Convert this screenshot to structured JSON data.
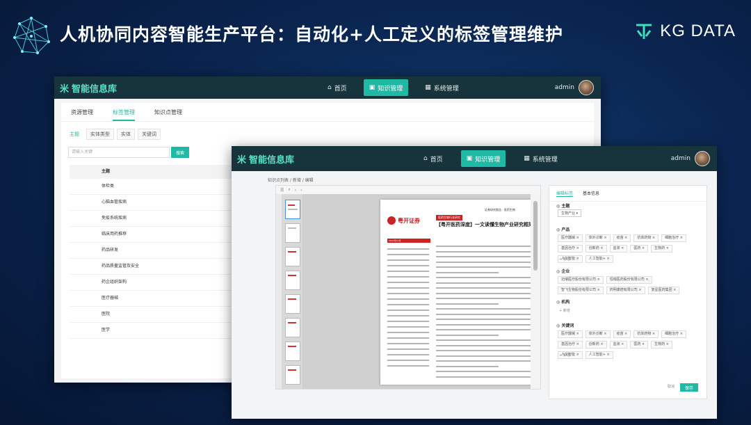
{
  "slide": {
    "title": "人机协同内容智能生产平台：自动化+人工定义的标签管理维护",
    "brand": "KG DATA"
  },
  "app": {
    "logo_text": "智能信息库",
    "nav": {
      "home": "首页",
      "knowledge": "知识管理",
      "system": "系统管理"
    },
    "user": "admin"
  },
  "back_window": {
    "tabs": [
      "资源管理",
      "标签管理",
      "知识点管理"
    ],
    "subtabs": [
      "主题",
      "实体类型",
      "实体",
      "关键词"
    ],
    "search_placeholder": "请输入关键",
    "search_button": "搜索",
    "table_header": "主题",
    "rows": [
      "体检类",
      "心脑血管疾病",
      "免疫系统疾病",
      "临床用药推荐",
      "药品研发",
      "药品质量监管及安全",
      "药企组织架构",
      "医疗器械",
      "医院",
      "医学"
    ]
  },
  "front_window": {
    "breadcrumb": "知识点列表 / 新增 / 编辑",
    "document": {
      "header_line": "证券研究报告 · 医药生物",
      "broker": "粤开证券",
      "tag": "医药生物行业研究",
      "title": "【粤开医药深度】一文读懂生物产业研究框架",
      "date_bar": "2021年12月"
    },
    "tag_panel": {
      "tabs": [
        "编辑标签",
        "基本信息"
      ],
      "sections": {
        "topic": "主题",
        "product": "产品",
        "company": "企业",
        "person": "机构",
        "keyword": "关键词"
      },
      "topic_value": "生物产业",
      "product_chips": [
        "医疗器械",
        "体外诊断",
        "疫苗",
        "抗体药物",
        "细胞治疗",
        "基因治疗",
        "创新药",
        "血液",
        "医药",
        "生物药",
        "人工智能",
        "人工智能+"
      ],
      "company_chips": [
        "迈瑞医疗股份有限公司",
        "恒瑞医药股份有限公司",
        "智飞生物股份有限公司",
        "药明康德有限公司",
        "复星医药集团"
      ],
      "keyword_chips": [
        "医疗器械",
        "体外诊断",
        "疫苗",
        "抗体药物",
        "细胞治疗",
        "基因治疗",
        "创新药",
        "血液",
        "医药",
        "生物药",
        "人工智能",
        "人工智能+"
      ],
      "add_label": "+ 新增",
      "cancel": "取消",
      "save": "保存"
    }
  }
}
